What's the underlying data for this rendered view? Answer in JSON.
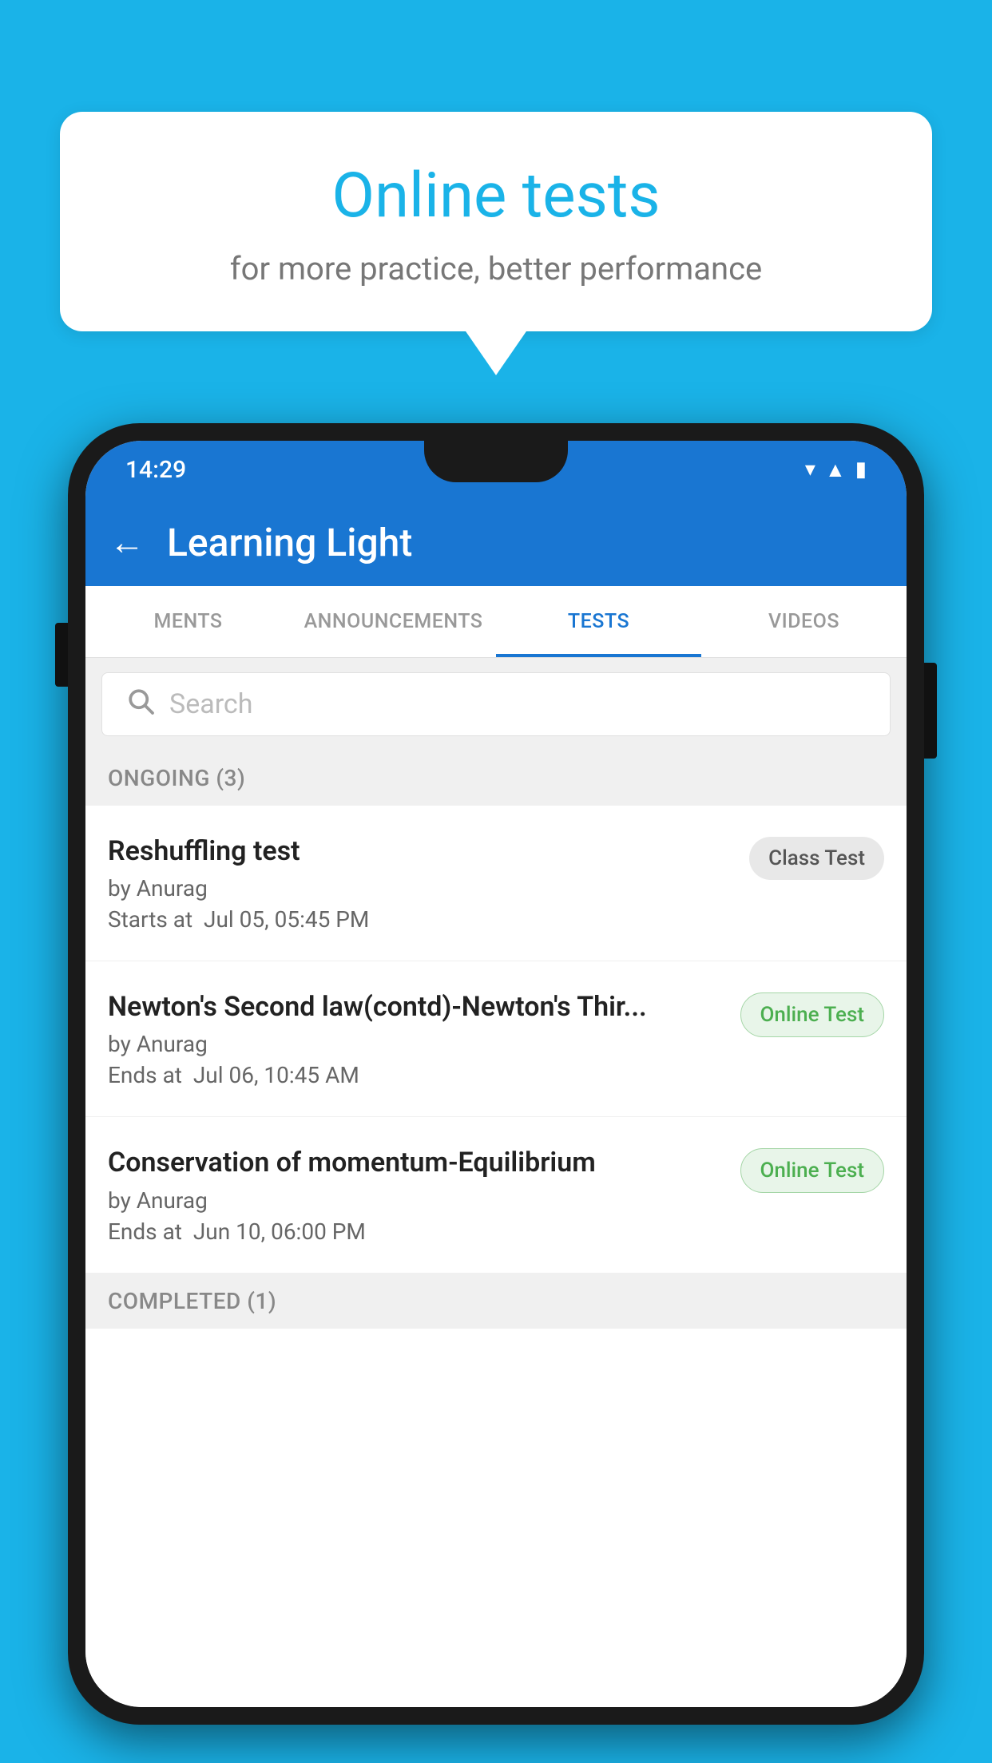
{
  "background_color": "#1ab3e8",
  "speech_bubble": {
    "title": "Online tests",
    "subtitle": "for more practice, better performance"
  },
  "phone": {
    "status_bar": {
      "time": "14:29",
      "icons": [
        "wifi",
        "signal",
        "battery"
      ]
    },
    "app_bar": {
      "title": "Learning Light",
      "back_label": "←"
    },
    "tabs": [
      {
        "label": "MENTS",
        "active": false
      },
      {
        "label": "ANNOUNCEMENTS",
        "active": false
      },
      {
        "label": "TESTS",
        "active": true
      },
      {
        "label": "VIDEOS",
        "active": false
      }
    ],
    "search": {
      "placeholder": "Search"
    },
    "ongoing_section": {
      "header": "ONGOING (3)",
      "items": [
        {
          "title": "Reshuffling test",
          "author": "by Anurag",
          "time_label": "Starts at",
          "time_value": "Jul 05, 05:45 PM",
          "badge": "Class Test",
          "badge_type": "class"
        },
        {
          "title": "Newton's Second law(contd)-Newton's Thir...",
          "author": "by Anurag",
          "time_label": "Ends at",
          "time_value": "Jul 06, 10:45 AM",
          "badge": "Online Test",
          "badge_type": "online"
        },
        {
          "title": "Conservation of momentum-Equilibrium",
          "author": "by Anurag",
          "time_label": "Ends at",
          "time_value": "Jun 10, 06:00 PM",
          "badge": "Online Test",
          "badge_type": "online"
        }
      ]
    },
    "completed_section": {
      "header": "COMPLETED (1)"
    }
  }
}
